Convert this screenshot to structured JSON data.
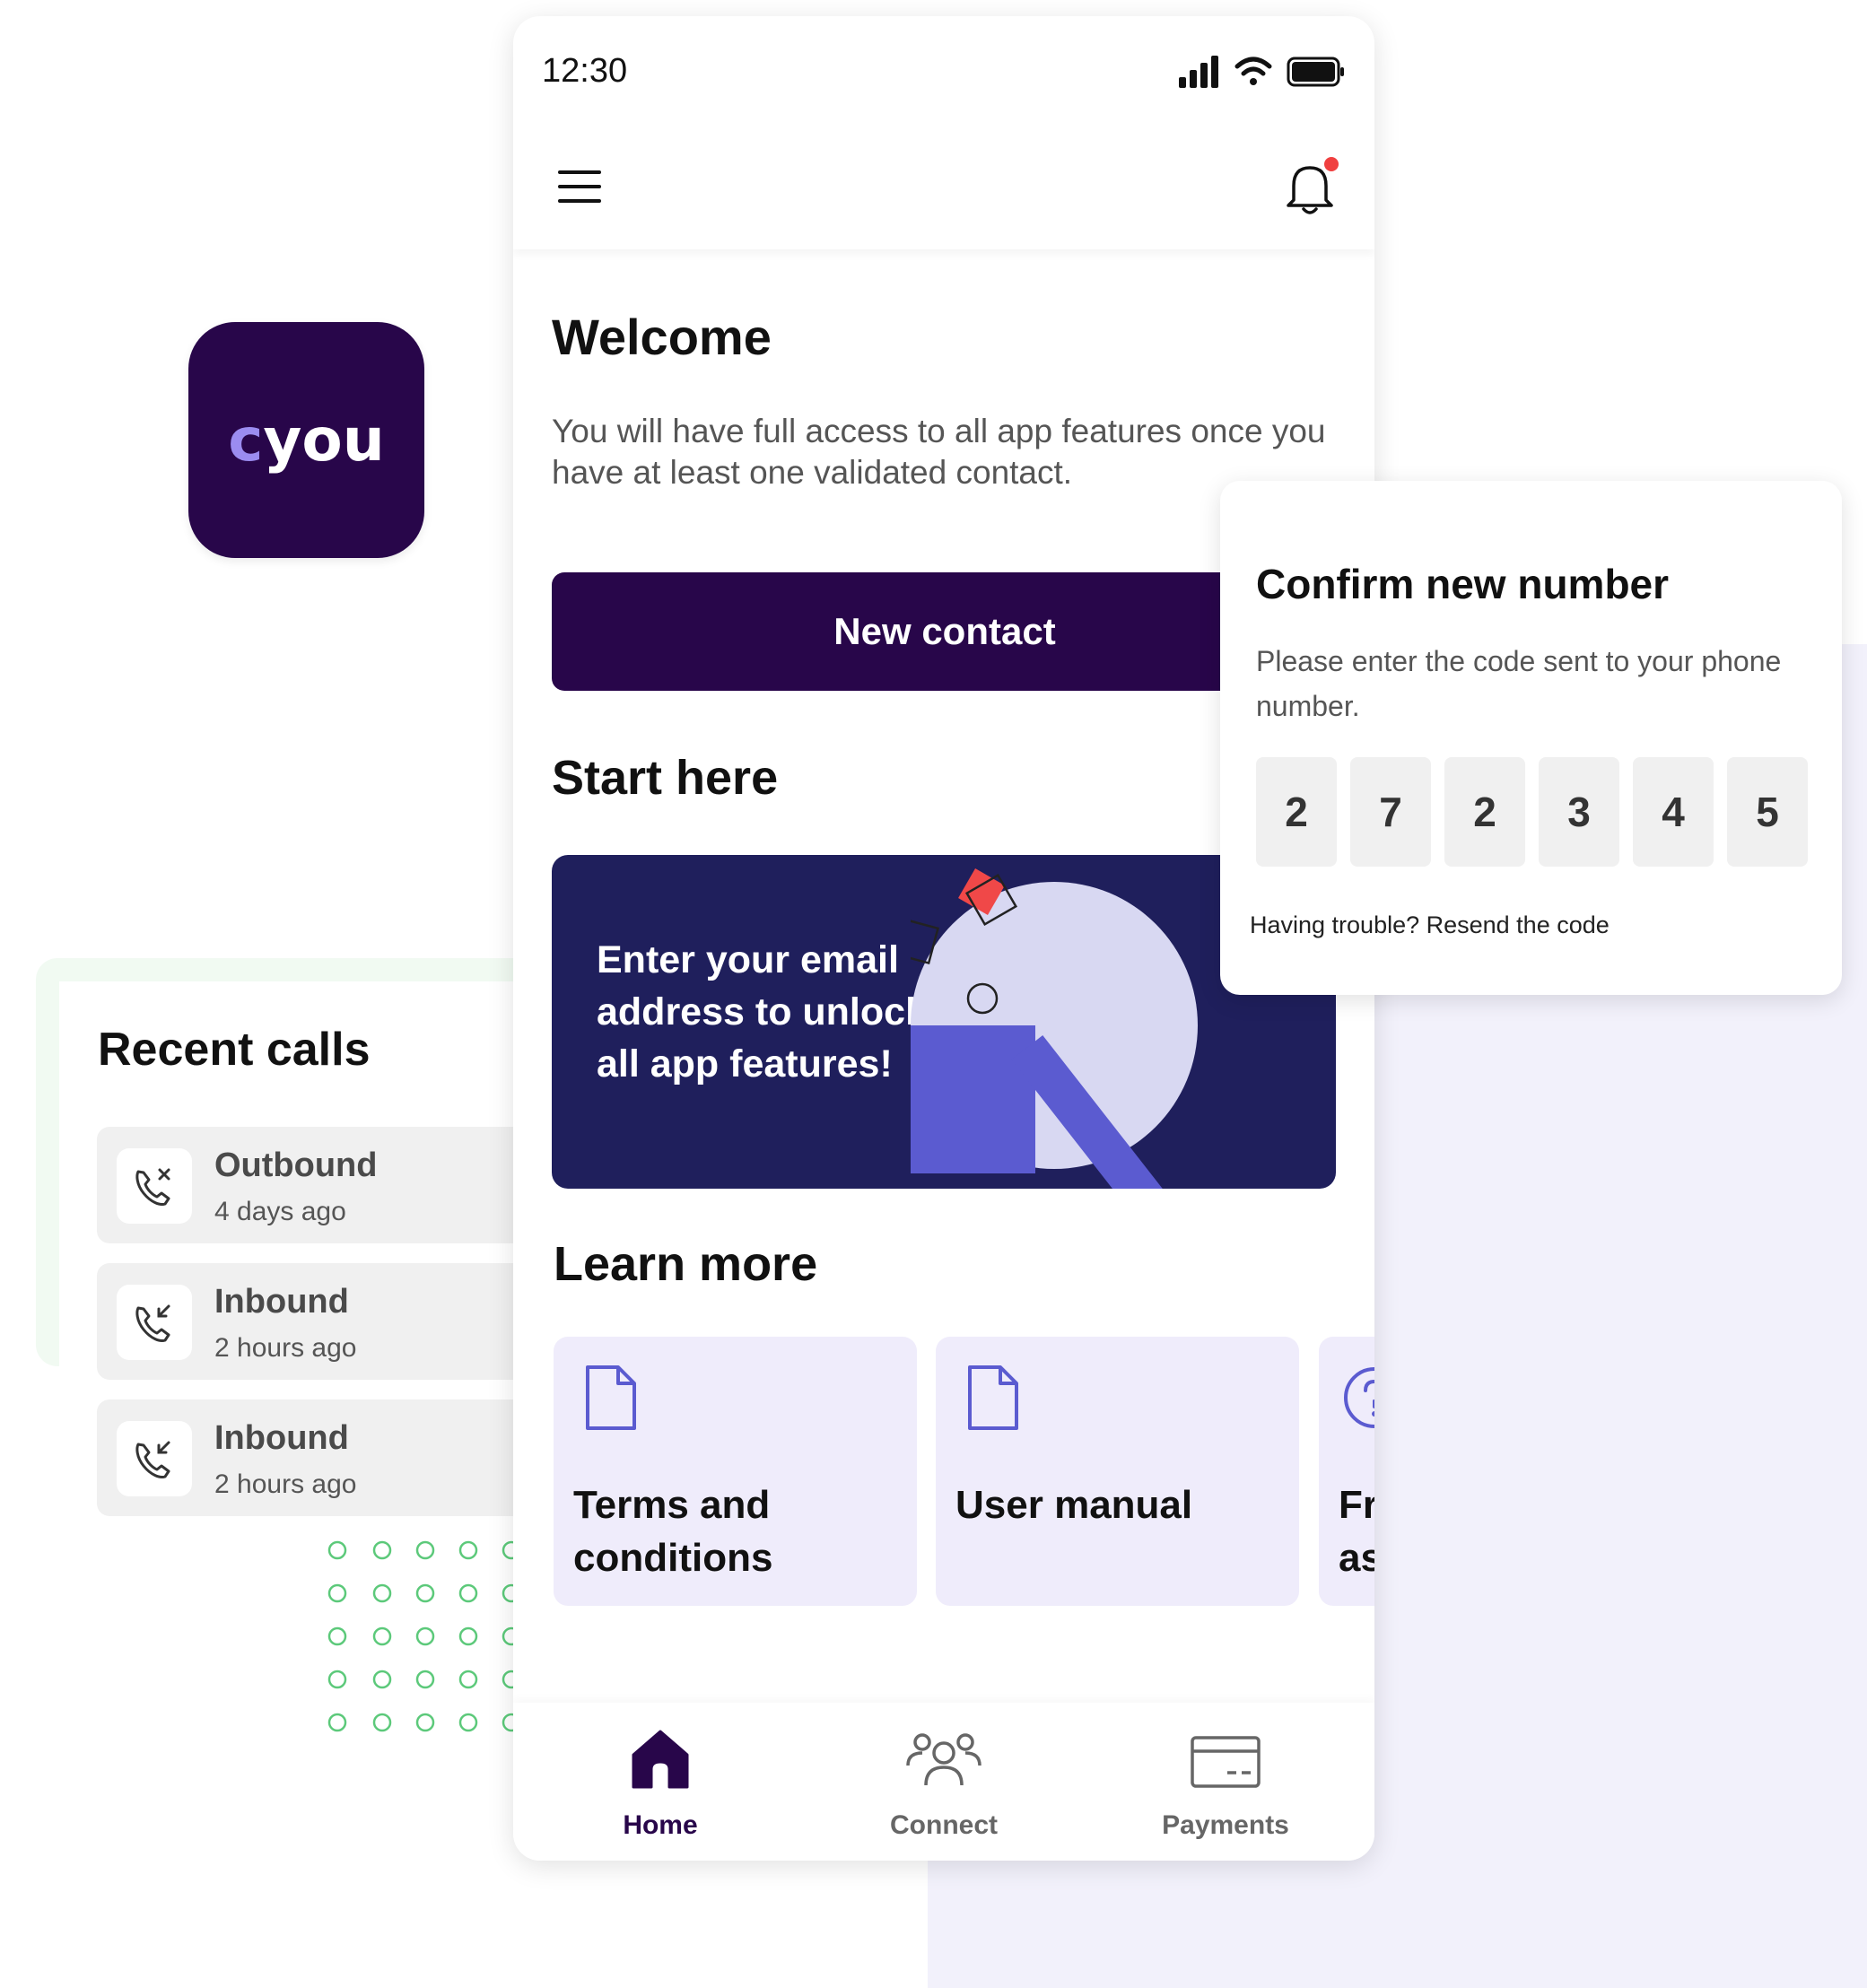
{
  "app_icon": {
    "logo_c": "c",
    "logo_rest": "you",
    "bg_color": "#28064a"
  },
  "recent_calls": {
    "title": "Recent calls",
    "items": [
      {
        "type": "Outbound",
        "time": "4 days ago",
        "icon": "phone-outgoing-missed-icon"
      },
      {
        "type": "Inbound",
        "time": "2 hours ago",
        "icon": "phone-incoming-icon"
      },
      {
        "type": "Inbound",
        "time": "2 hours ago",
        "icon": "phone-incoming-icon"
      }
    ]
  },
  "status_bar": {
    "time": "12:30"
  },
  "header": {
    "menu_icon": "hamburger-icon",
    "notification_icon": "bell-icon"
  },
  "welcome": {
    "title": "Welcome",
    "text": "You will have full access to all app features once you have at least one validated contact."
  },
  "new_contact_button": "New contact",
  "start_here": {
    "title": "Start here",
    "banner_text": "Enter your email address to unlock all app features!"
  },
  "learn_more": {
    "title": "Learn more",
    "cards": [
      {
        "label": "Terms and conditions",
        "icon": "document-icon"
      },
      {
        "label": "User manual",
        "icon": "document-icon"
      },
      {
        "label": "Fr as",
        "icon": "help-circle-icon"
      }
    ]
  },
  "bottom_nav": {
    "items": [
      {
        "label": "Home",
        "icon": "home-icon",
        "active": true
      },
      {
        "label": "Connect",
        "icon": "people-icon",
        "active": false
      },
      {
        "label": "Payments",
        "icon": "card-icon",
        "active": false
      }
    ]
  },
  "confirm": {
    "title": "Confirm new number",
    "text": "Please enter the code sent to your phone number.",
    "code": [
      "2",
      "7",
      "2",
      "3",
      "4",
      "5"
    ],
    "resend": "Having trouble? Resend the code"
  },
  "colors": {
    "primary": "#28064a",
    "banner": "#1f1f5c",
    "accent": "#5b5bd0",
    "card_bg": "#efecfb",
    "notification_dot": "#f04040"
  }
}
